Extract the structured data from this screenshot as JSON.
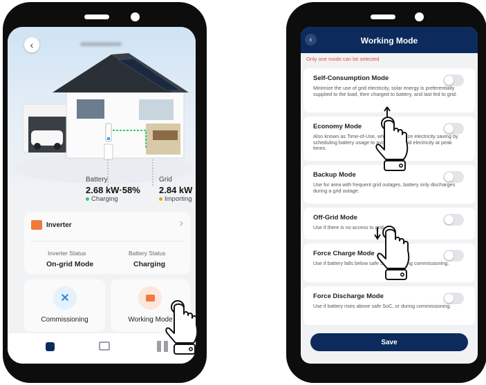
{
  "left_screen": {
    "battery": {
      "label": "Battery",
      "value": "2.68 kW·58%",
      "status": "Charging",
      "status_color": "#2ecc71"
    },
    "grid": {
      "label": "Grid",
      "value": "2.84 kW",
      "status": "Importing",
      "status_color": "#f39c12"
    },
    "inverter_card": {
      "title": "Inverter",
      "inverter_status_label": "Inverter Status",
      "inverter_status_value": "On-grid Mode",
      "battery_status_label": "Battery Status",
      "battery_status_value": "Charging"
    },
    "tiles": [
      {
        "label": "Commissioning",
        "icon": "tools-icon"
      },
      {
        "label": "Working Mode",
        "icon": "inverter-box-icon"
      }
    ],
    "tabbar": [
      "home-icon",
      "devices-icon",
      "grid-apps-icon"
    ]
  },
  "right_screen": {
    "title": "Working Mode",
    "notice": "Only one mode can be selected",
    "modes": [
      {
        "title": "Self-Consumption Mode",
        "desc": "Minimize the use of grid electricity, solar energy is preferentially supplied to the load, then charged to battery, and last fed to grid.",
        "enabled": false
      },
      {
        "title": "Economy Mode",
        "desc": "Also known as Time-of-Use, which maximize electricity saving by scheduling battery usage to avoid using grid electricity at peak times.",
        "enabled": false
      },
      {
        "title": "Backup Mode",
        "desc": "Use for area with frequent grid outages, battery only discharges during a grid outage.",
        "enabled": false
      },
      {
        "title": "Off-Grid Mode",
        "desc": "Use if there is no access to grid.",
        "enabled": false
      },
      {
        "title": "Force Charge Mode",
        "desc": "Use if battery falls below safe SoC, or during commissioning.",
        "enabled": false
      },
      {
        "title": "Force Discharge Mode",
        "desc": "Use if battery rises above safe SoC, or during commissioning.",
        "enabled": false
      }
    ],
    "save_label": "Save",
    "accent": "#0c2a5c"
  }
}
